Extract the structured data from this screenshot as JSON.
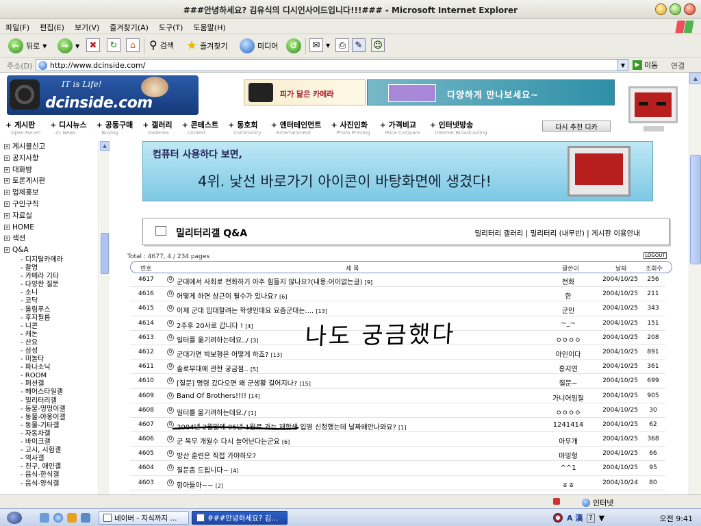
{
  "window": {
    "title": "###안녕하세요? 김유식의 디시인사이드입니다!!!### - Microsoft Internet Explorer"
  },
  "menu": [
    "파일(F)",
    "편집(E)",
    "보기(V)",
    "즐겨찾기(A)",
    "도구(T)",
    "도움말(H)"
  ],
  "toolbar": {
    "back": "뒤로",
    "search": "검색",
    "favorites": "즐겨찾기",
    "media": "미디어"
  },
  "address": {
    "label": "주소(D)",
    "url": "http://www.dcinside.com/",
    "go": "이동",
    "links": "연결"
  },
  "site": {
    "tagline": "IT is Life!",
    "logo_text": "dcinside.com",
    "banner1": "피가 닮은 카메라",
    "banner2": "다양하게 만나보세요~",
    "again_button": "다시 추천 디카"
  },
  "nav": [
    {
      "ko": "게시판",
      "en": "Open Forum"
    },
    {
      "ko": "디시뉴스",
      "en": "dc News"
    },
    {
      "ko": "공동구매",
      "en": "Buying"
    },
    {
      "ko": "갤러리",
      "en": "Galleries"
    },
    {
      "ko": "콘테스트",
      "en": "Contest"
    },
    {
      "ko": "동호회",
      "en": "Community"
    },
    {
      "ko": "엔터테인먼트",
      "en": "Entertainment"
    },
    {
      "ko": "사진인화",
      "en": "Photo Printing"
    },
    {
      "ko": "가격비교",
      "en": "Price Compare"
    },
    {
      "ko": "인터넷방송",
      "en": "Internet Broadcasting"
    }
  ],
  "sidebar": {
    "items": [
      "게시물신고",
      "공지사항",
      "대화방",
      "토론게시판",
      "업체홍보",
      "구인구직",
      "자료실",
      "HOME",
      "섹션",
      "Q&A"
    ],
    "subitems": [
      "디지탈카메라",
      "촬영",
      "카메라 기타",
      "다양한 질문",
      "소니",
      "코닥",
      "올림푸스",
      "후지필름",
      "니콘",
      "캐논",
      "산요",
      "삼성",
      "미놀타",
      "파나소닉",
      "ROOM",
      "퍼션갤",
      "헤어스타일갤",
      "밀리터리갤",
      "동물-멍멍이갤",
      "동물-야옹이갤",
      "동물-기타갤",
      "자동차갤",
      "바이크갤",
      "고시, 시험갤",
      "역사갤",
      "친구, 애인갤",
      "음식-한식갤",
      "음식-양식갤"
    ]
  },
  "ad": {
    "line1": "컴퓨터 사용하다 보면,",
    "line2": "4위. 낯선 바로가기 아이콘이 바탕화면에 생겼다!"
  },
  "board": {
    "title": "밀리터리갤 Q&A",
    "links": "밀리터리 갤러리 | 밀리터리 (내무반) | 게시판 이용안내",
    "total": "Total : 4677, 4 / 234 pages",
    "logout": "LOGOUT",
    "columns": {
      "no": "번호",
      "subject": "제 목",
      "writer": "글쓴이",
      "date": "날짜",
      "views": "조회수"
    },
    "rows": [
      {
        "no": "4617",
        "subject": "군대에서 사회로 전화하기 아주 힘들지 않나요?(내용:어이없는글)",
        "count": "[9]",
        "writer": "전화",
        "date": "2004/10/25",
        "views": "256"
      },
      {
        "no": "4616",
        "subject": "어떻게 하면 상근이 될수가 있나요?",
        "count": "[6]",
        "writer": "한",
        "date": "2004/10/25",
        "views": "211"
      },
      {
        "no": "4615",
        "subject": "이제 군대 입대할려는 학생인데요 요즘군대는....",
        "count": "[13]",
        "writer": "군인",
        "date": "2004/10/25",
        "views": "343"
      },
      {
        "no": "4614",
        "subject": "2주후 20사로 갑니다 !",
        "count": "[4]",
        "writer": "~_~",
        "date": "2004/10/25",
        "views": "151"
      },
      {
        "no": "4613",
        "subject": "일터를 옮기려하는데요../",
        "count": "[3]",
        "writer": "ㅇㅇㅇㅇ",
        "date": "2004/10/25",
        "views": "208"
      },
      {
        "no": "4612",
        "subject": "군대가면 박보형은 어떻게 하죠?",
        "count": "[13]",
        "writer": "아인이다",
        "date": "2004/10/25",
        "views": "891"
      },
      {
        "no": "4611",
        "subject": "솔로부대에 관한 궁금점..",
        "count": "[5]",
        "writer": "홍지연",
        "date": "2004/10/25",
        "views": "361"
      },
      {
        "no": "4610",
        "subject": "[질문] 명령 갔다오면 왜 군생활 길어지나?",
        "count": "[15]",
        "writer": "질문~",
        "date": "2004/10/25",
        "views": "699"
      },
      {
        "no": "4609",
        "subject": "Band Of Brothers!!!!",
        "count": "[14]",
        "writer": "가니어임질",
        "date": "2004/10/25",
        "views": "905"
      },
      {
        "no": "4608",
        "subject": "일터를 옮기려하는데요./",
        "count": "[1]",
        "writer": "ㅇㅇㅇㅇ",
        "date": "2004/10/25",
        "views": "30"
      },
      {
        "no": "4607",
        "subject": "2004년 2월말에 05년 1월로 가는 재학생 입영 신청했는데 날짜왜안나와요?",
        "count": "[1]",
        "writer": "1241414",
        "date": "2004/10/25",
        "views": "62"
      },
      {
        "no": "4606",
        "subject": "군 복무 개월수 다시 늘어난다는군요",
        "count": "[6]",
        "writer": "아무개",
        "date": "2004/10/25",
        "views": "368"
      },
      {
        "no": "4605",
        "subject": "방산 훈련은 직접 가야하오?",
        "count": "",
        "writer": "마밍헝",
        "date": "2004/10/25",
        "views": "66"
      },
      {
        "no": "4604",
        "subject": "질문좀 드립니다~",
        "count": "[4]",
        "writer": "^^1",
        "date": "2004/10/25",
        "views": "95"
      },
      {
        "no": "4603",
        "subject": "헝아들아~~",
        "count": "[2]",
        "writer": "ㅎㅎ",
        "date": "2004/10/24",
        "views": "80"
      }
    ]
  },
  "annotation": "나도 궁금했다",
  "status": {
    "zone": "인터넷"
  },
  "taskbar": {
    "windows": [
      "네이버 - 지식까지 ...",
      "###안녕하세요? 김..."
    ],
    "ime": "A 漢",
    "clock": "오전 9:41"
  },
  "colors": {
    "nav_blue": "#1c46a6",
    "banner_sky": "#7cc8e4",
    "header_blue": "#163a7a"
  }
}
